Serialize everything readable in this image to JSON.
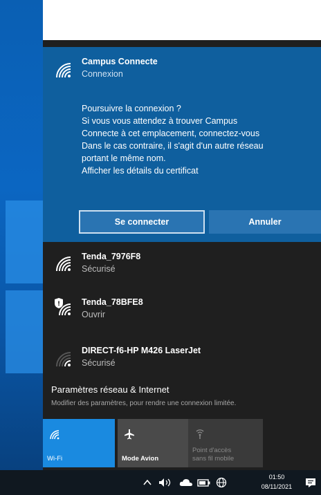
{
  "active_network": {
    "name": "Campus Connecte",
    "status": "Connexion",
    "message_lines": [
      "Poursuivre la connexion ?",
      "Si vous vous attendez à trouver Campus",
      "Connecte à cet emplacement, connectez-vous",
      "Dans le cas contraire, il s'agit d'un autre réseau",
      "portant le même nom."
    ],
    "cert_link": "Afficher les détails du certificat",
    "connect_label": "Se connecter",
    "cancel_label": "Annuler"
  },
  "networks": [
    {
      "name": "Tenda_7976F8",
      "status": "Sécurisé",
      "icon": "wifi-secured-icon"
    },
    {
      "name": "Tenda_78BFE8",
      "status": "Ouvrir",
      "icon": "wifi-open-shield-icon"
    },
    {
      "name": "DIRECT-f6-HP M426 LaserJet",
      "status": "Sécurisé",
      "icon": "wifi-weak-icon"
    }
  ],
  "settings": {
    "title": "Paramètres réseau & Internet",
    "subtitle": "Modifier des paramètres, pour rendre une connexion limitée."
  },
  "quick_actions": {
    "wifi": "Wi-Fi",
    "airplane": "Mode Avion",
    "hotspot_line1": "Point d'accès",
    "hotspot_line2": "sans fil mobile"
  },
  "taskbar": {
    "time": "01:50",
    "date": "08/11/2021"
  },
  "colors": {
    "active_bg": "#0f5f9e",
    "flyout_bg": "#1f1f1f",
    "accent": "#1a8ae0"
  }
}
